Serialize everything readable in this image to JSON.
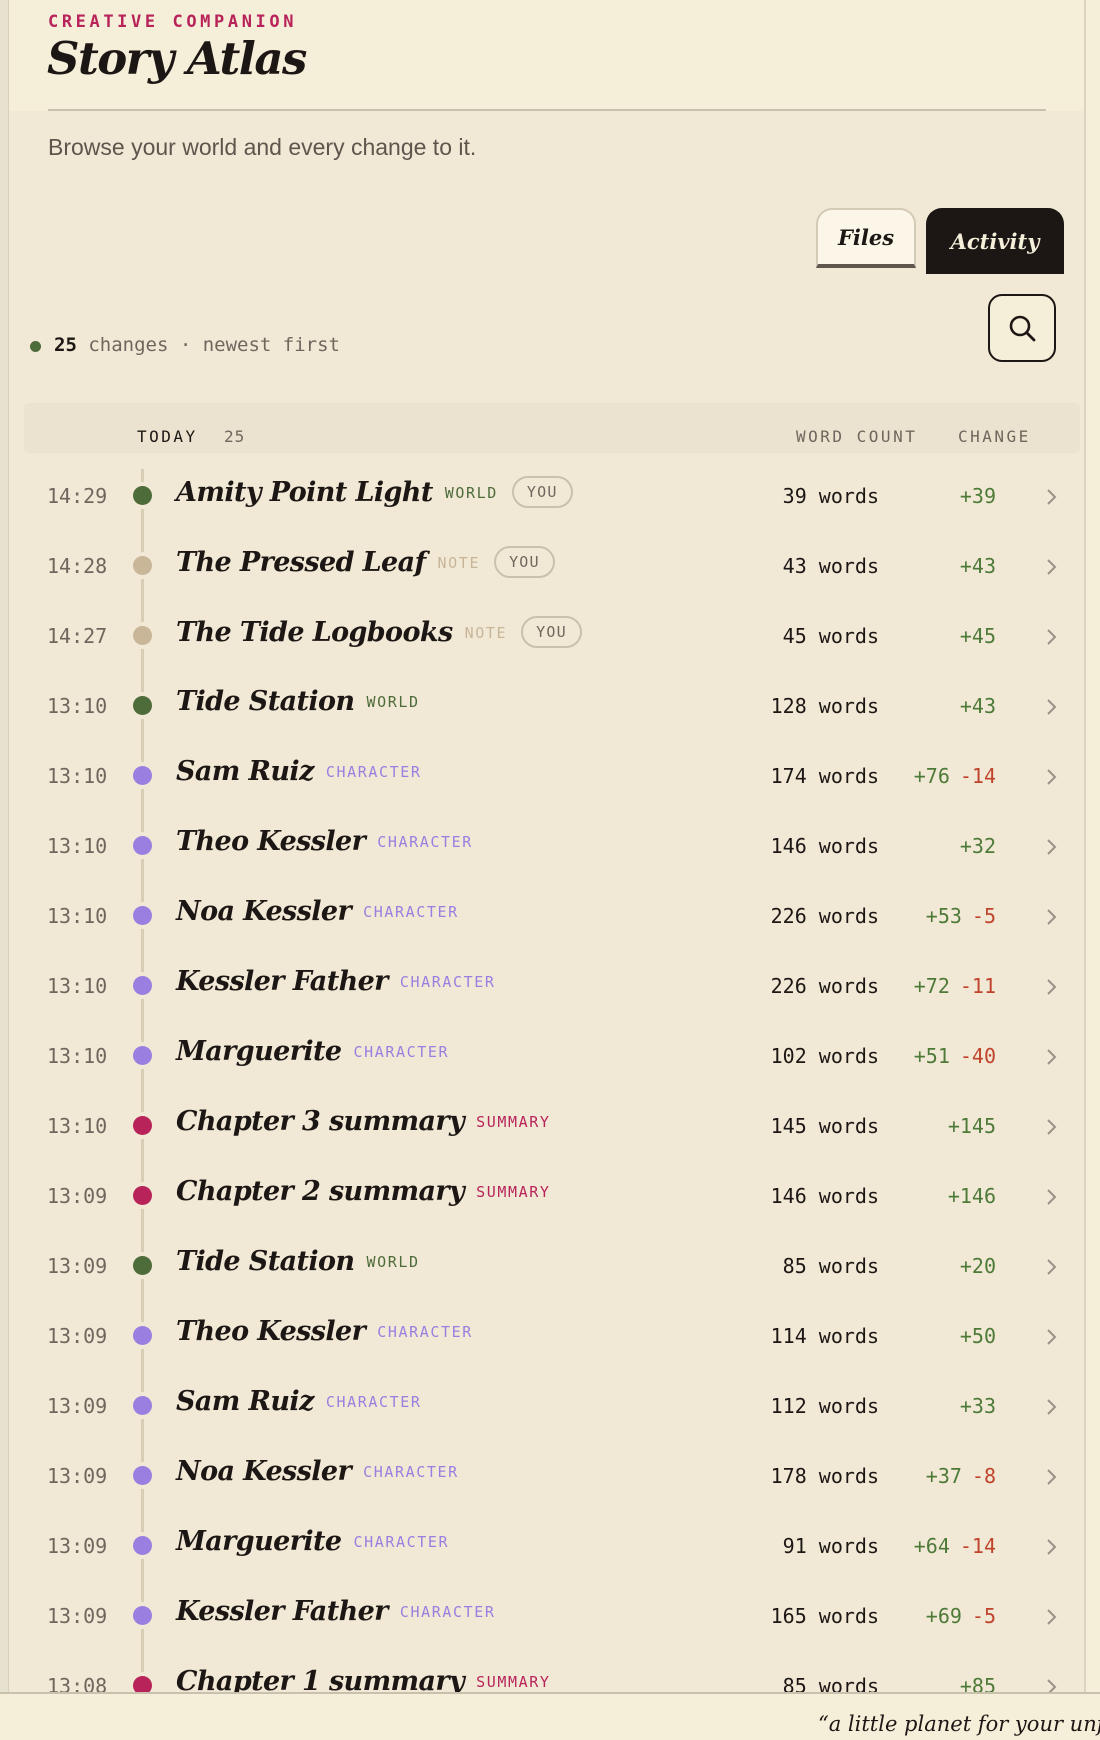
{
  "app": {
    "eyebrow": "CREATIVE COMPANION",
    "title": "Story Atlas",
    "subtitle": "Browse your world and every change to it."
  },
  "tabs": {
    "files": "Files",
    "activity": "Activity",
    "active": "activity"
  },
  "summary": {
    "count": "25",
    "text": " changes · newest first"
  },
  "list_header": {
    "group": "TODAY",
    "group_count": "25",
    "word_count": "WORD COUNT",
    "change": "CHANGE"
  },
  "colors": {
    "world": "#4e6b3a",
    "note": "#c9b699",
    "character": "#9b7fe0",
    "summary": "#b8245a",
    "plus": "#4e7a38",
    "minus": "#c0432c"
  },
  "rows": [
    {
      "time": "14:29",
      "name": "Amity Point Light",
      "type": "WORLD",
      "you": "YOU",
      "words": "39 words",
      "plus": "+39",
      "minus": ""
    },
    {
      "time": "14:28",
      "name": "The Pressed Leaf",
      "type": "NOTE",
      "you": "YOU",
      "words": "43 words",
      "plus": "+43",
      "minus": ""
    },
    {
      "time": "14:27",
      "name": "The Tide Logbooks",
      "type": "NOTE",
      "you": "YOU",
      "words": "45 words",
      "plus": "+45",
      "minus": ""
    },
    {
      "time": "13:10",
      "name": "Tide Station",
      "type": "WORLD",
      "you": "",
      "words": "128 words",
      "plus": "+43",
      "minus": ""
    },
    {
      "time": "13:10",
      "name": "Sam Ruiz",
      "type": "CHARACTER",
      "you": "",
      "words": "174 words",
      "plus": "+76",
      "minus": "-14"
    },
    {
      "time": "13:10",
      "name": "Theo Kessler",
      "type": "CHARACTER",
      "you": "",
      "words": "146 words",
      "plus": "+32",
      "minus": ""
    },
    {
      "time": "13:10",
      "name": "Noa Kessler",
      "type": "CHARACTER",
      "you": "",
      "words": "226 words",
      "plus": "+53",
      "minus": "-5"
    },
    {
      "time": "13:10",
      "name": "Kessler Father",
      "type": "CHARACTER",
      "you": "",
      "words": "226 words",
      "plus": "+72",
      "minus": "-11"
    },
    {
      "time": "13:10",
      "name": "Marguerite",
      "type": "CHARACTER",
      "you": "",
      "words": "102 words",
      "plus": "+51",
      "minus": "-40"
    },
    {
      "time": "13:10",
      "name": "Chapter 3 summary",
      "type": "SUMMARY",
      "you": "",
      "words": "145 words",
      "plus": "+145",
      "minus": ""
    },
    {
      "time": "13:09",
      "name": "Chapter 2 summary",
      "type": "SUMMARY",
      "you": "",
      "words": "146 words",
      "plus": "+146",
      "minus": ""
    },
    {
      "time": "13:09",
      "name": "Tide Station",
      "type": "WORLD",
      "you": "",
      "words": "85 words",
      "plus": "+20",
      "minus": ""
    },
    {
      "time": "13:09",
      "name": "Theo Kessler",
      "type": "CHARACTER",
      "you": "",
      "words": "114 words",
      "plus": "+50",
      "minus": ""
    },
    {
      "time": "13:09",
      "name": "Sam Ruiz",
      "type": "CHARACTER",
      "you": "",
      "words": "112 words",
      "plus": "+33",
      "minus": ""
    },
    {
      "time": "13:09",
      "name": "Noa Kessler",
      "type": "CHARACTER",
      "you": "",
      "words": "178 words",
      "plus": "+37",
      "minus": "-8"
    },
    {
      "time": "13:09",
      "name": "Marguerite",
      "type": "CHARACTER",
      "you": "",
      "words": "91 words",
      "plus": "+64",
      "minus": "-14"
    },
    {
      "time": "13:09",
      "name": "Kessler Father",
      "type": "CHARACTER",
      "you": "",
      "words": "165 words",
      "plus": "+69",
      "minus": "-5"
    },
    {
      "time": "13:08",
      "name": "Chapter 1 summary",
      "type": "SUMMARY",
      "you": "",
      "words": "85 words",
      "plus": "+85",
      "minus": ""
    }
  ],
  "footer": {
    "quote": "“a little planet for your unfinis"
  }
}
